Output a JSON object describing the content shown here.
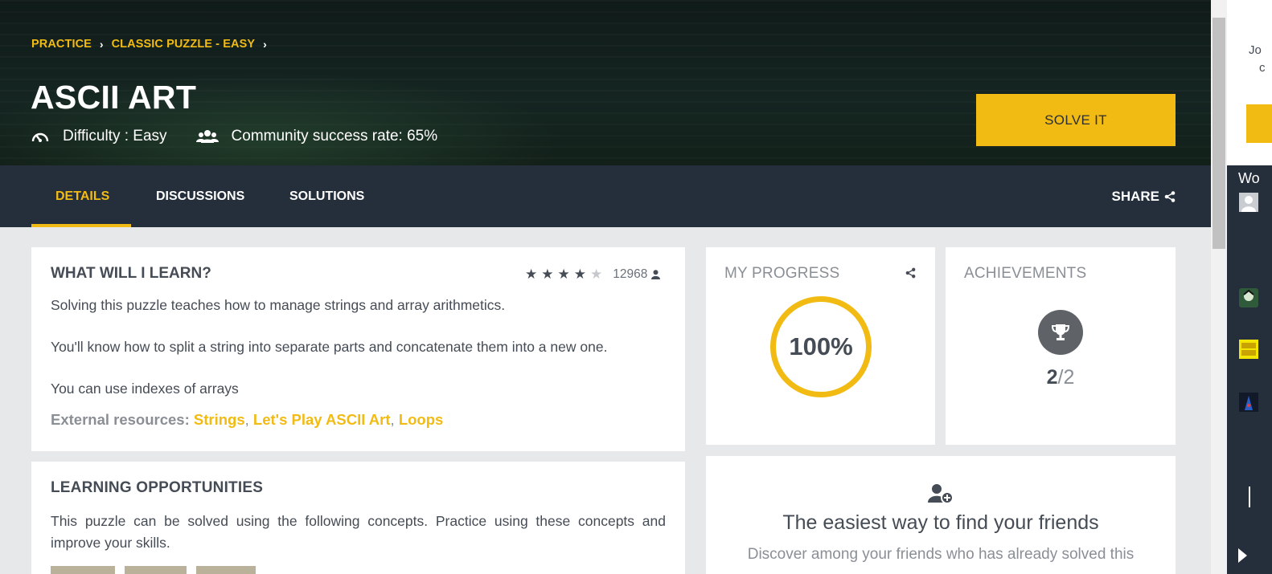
{
  "hero": {
    "breadcrumb": [
      "PRACTICE",
      "CLASSIC PUZZLE - EASY"
    ],
    "title": "ASCII ART",
    "difficulty": "Difficulty : Easy",
    "success_rate": "Community success rate: 65%",
    "solve_label": "SOLVE IT"
  },
  "tabs": {
    "items": [
      "DETAILS",
      "DISCUSSIONS",
      "SOLUTIONS"
    ],
    "active": "DETAILS",
    "share_label": "SHARE"
  },
  "learn": {
    "title": "WHAT WILL I LEARN?",
    "rating_stars": 4,
    "rating_max": 5,
    "rating_count": "12968",
    "paragraphs": [
      "Solving this puzzle teaches how to manage strings and array arithmetics.",
      "You'll know how to split a string into separate parts and concatenate them into a new one.",
      "You can use indexes of arrays"
    ],
    "external_label": "External resources:",
    "resources": [
      "Strings",
      "Let's Play ASCII Art",
      "Loops"
    ]
  },
  "opportunities": {
    "title": "LEARNING OPPORTUNITIES",
    "description": "This puzzle can be solved using the following concepts. Practice using these concepts and improve your skills."
  },
  "progress": {
    "label": "MY PROGRESS",
    "value": "100%"
  },
  "achievements": {
    "label": "ACHIEVEMENTS",
    "earned": "2",
    "total": "/2"
  },
  "friends": {
    "title": "The easiest way to find your friends",
    "description": "Discover among your friends who has already solved this"
  },
  "side_panel": {
    "top_text_1": "Jo",
    "top_text_2": "c",
    "world_label": "Wo"
  },
  "colors": {
    "accent": "#f2bb13",
    "nav_bg": "#252e3b",
    "text": "#454c55",
    "muted": "#8a8f96"
  }
}
